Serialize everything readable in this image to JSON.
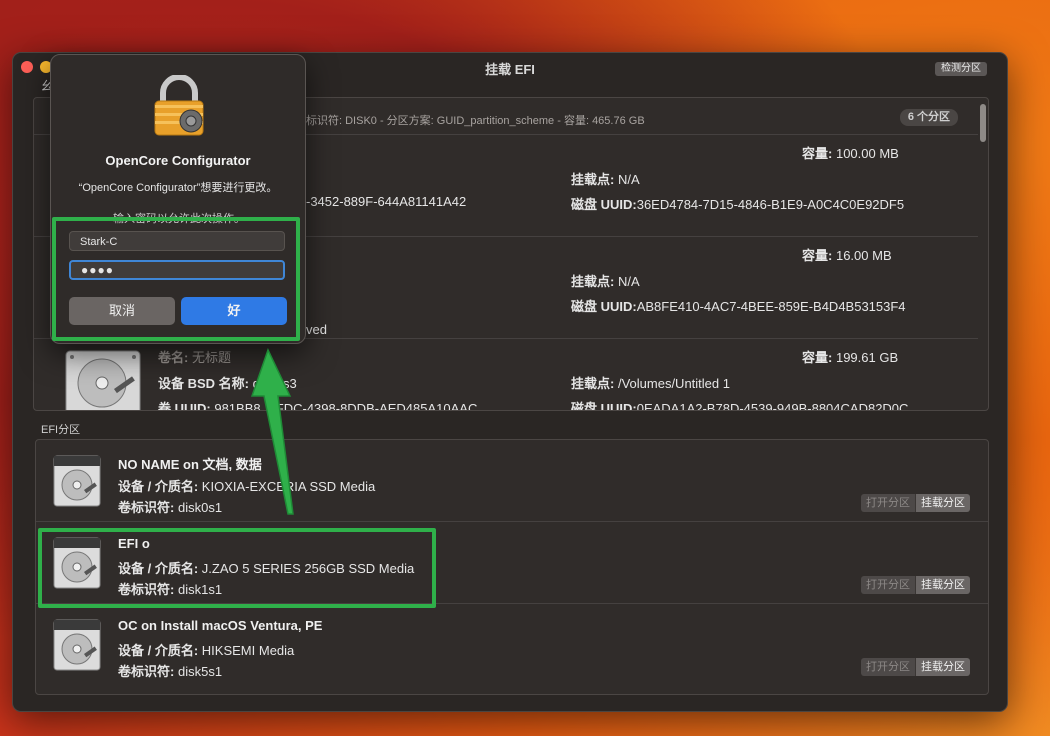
{
  "window": {
    "title": "挂载 EFI",
    "detect_button": "检测分区",
    "section_label_fragment": "幺"
  },
  "disk": {
    "header_text": "标识符: DISK0 - 分区方案: GUID_partition_scheme - 容量: 465.76 GB",
    "partition_count": "6 个分区",
    "partitions": [
      {
        "capacity_label": "容量:",
        "capacity_value": "100.00 MB",
        "mount_label": "挂载点:",
        "mount_value": "N/A",
        "uuid_label": "磁盘 UUID:",
        "uuid_value": "36ED4784-7D15-4846-B1E9-A0C4C0E92DF5",
        "uuid_fragment": "-3452-889F-644A81141A42"
      },
      {
        "capacity_label": "容量:",
        "capacity_value": "16.00 MB",
        "mount_label": "挂载点:",
        "mount_value": "N/A",
        "uuid_label": "磁盘 UUID:",
        "uuid_value": "AB8FE410-4AC7-4BEE-859E-B4D4B53153F4",
        "type_fragment": "ved"
      },
      {
        "volume_label": "卷名:",
        "volume_value": "无标题",
        "bsd_label": "设备 BSD 名称:",
        "bsd_value": "disk0s3",
        "vol_uuid_label": "卷 UUID:",
        "vol_uuid_value": "981BB8...-FDC-4398-8DDB-AED485A10AAC",
        "capacity_label": "容量:",
        "capacity_value": "199.61 GB",
        "mount_label": "挂载点:",
        "mount_value": "/Volumes/Untitled 1",
        "uuid_label": "磁盘 UUID:",
        "uuid_value": "0EADA1A2-B78D-4539-949B-8804CAD82D0C"
      }
    ]
  },
  "efi": {
    "section_label": "EFI分区",
    "items": [
      {
        "name": "NO NAME on 文档, 数据",
        "media_label": "设备 / 介质名:",
        "media_value": "KIOXIA-EXCERIA SSD Media",
        "id_label": "卷标识符:",
        "id_value": "disk0s1",
        "open_label": "打开分区",
        "mount_label": "挂载分区"
      },
      {
        "name": "EFI o",
        "media_label": "设备 / 介质名:",
        "media_value": "J.ZAO 5 SERIES 256GB SSD Media",
        "id_label": "卷标识符:",
        "id_value": "disk1s1",
        "open_label": "打开分区",
        "mount_label": "挂载分区"
      },
      {
        "name": "OC on Install macOS Ventura, PE",
        "media_label": "设备 / 介质名:",
        "media_value": "HIKSEMI Media",
        "id_label": "卷标识符:",
        "id_value": "disk5s1",
        "open_label": "打开分区",
        "mount_label": "挂载分区"
      }
    ]
  },
  "auth_dialog": {
    "title": "OpenCore Configurator",
    "message": "“OpenCore Configurator”想要进行更改。",
    "hint": "输入密码以允许此次操作。",
    "username": "Stark-C",
    "password_mask": "●●●●",
    "cancel_label": "取消",
    "ok_label": "好"
  },
  "colors": {
    "highlight": "#2fb04a",
    "accent_blue": "#2f7ae5",
    "window_bg": "#2a2624"
  }
}
